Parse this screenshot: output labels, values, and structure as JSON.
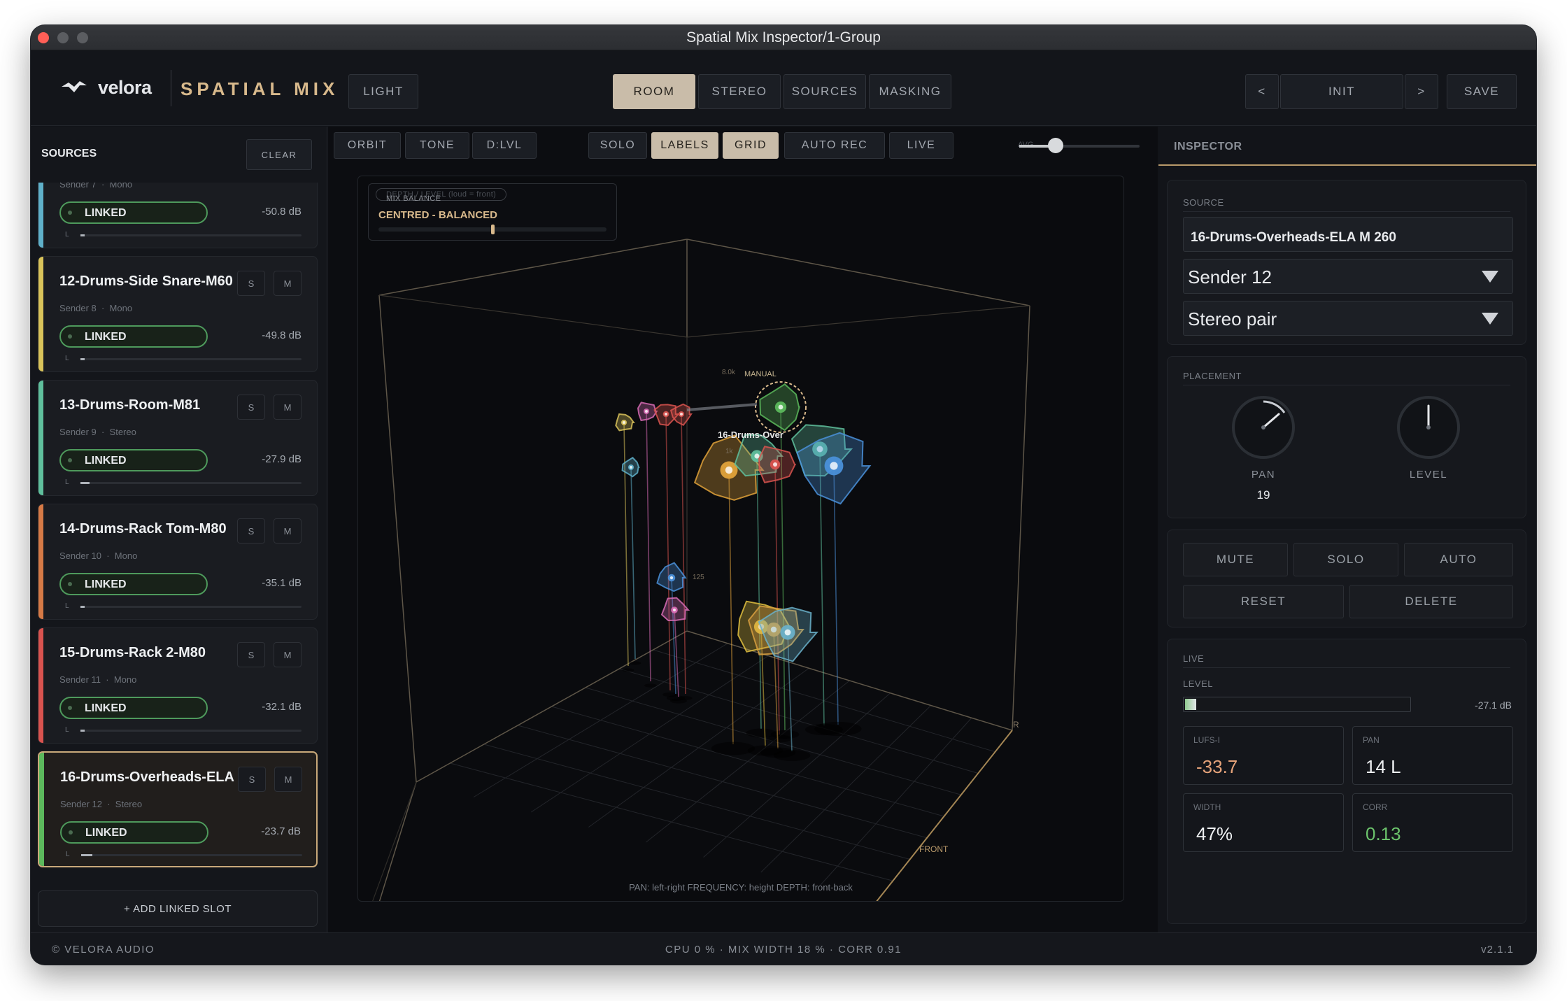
{
  "window": {
    "title": "Spatial Mix Inspector/1-Group"
  },
  "header": {
    "brand": "velora",
    "product": "SPATIAL MIX",
    "theme_button": "LIGHT",
    "view_tabs": [
      {
        "label": "ROOM",
        "active": true
      },
      {
        "label": "STEREO",
        "active": false
      },
      {
        "label": "SOURCES",
        "active": false
      },
      {
        "label": "MASKING",
        "active": false
      }
    ],
    "prev": "<",
    "preset": "INIT",
    "next": ">",
    "save": "SAVE"
  },
  "sidebar": {
    "title": "SOURCES",
    "clear": "CLEAR",
    "add_slot": "+ ADD LINKED SLOT",
    "s_label": "S",
    "m_label": "M",
    "link_label": "LINKED",
    "level_prefix": "L",
    "sources": [
      {
        "name": "",
        "sender": "Sender 7",
        "type": "Mono",
        "db": "-50.8 dB",
        "color": "#5fb0c9",
        "level": 0.02
      },
      {
        "name": "12-Drums-Side Snare-M60",
        "sender": "Sender 8",
        "type": "Mono",
        "db": "-49.8 dB",
        "color": "#d9c35a",
        "level": 0.02
      },
      {
        "name": "13-Drums-Room-M81",
        "sender": "Sender 9",
        "type": "Stereo",
        "db": "-27.9 dB",
        "color": "#5fbf9c",
        "level": 0.04
      },
      {
        "name": "14-Drums-Rack Tom-M80",
        "sender": "Sender 10",
        "type": "Mono",
        "db": "-35.1 dB",
        "color": "#d67a46",
        "level": 0.02
      },
      {
        "name": "15-Drums-Rack 2-M80",
        "sender": "Sender 11",
        "type": "Mono",
        "db": "-32.1 dB",
        "color": "#d9534f",
        "level": 0.02
      },
      {
        "name": "16-Drums-Overheads-ELA ...",
        "sender": "Sender 12",
        "type": "Stereo",
        "db": "-23.7 dB",
        "color": "#5cb85c",
        "level": 0.05,
        "selected": true
      }
    ]
  },
  "toolbar": {
    "buttons": [
      {
        "label": "ORBIT",
        "active": false
      },
      {
        "label": "TONE",
        "active": false
      },
      {
        "label": "D:LVL",
        "active": false
      },
      {
        "label": "SOLO",
        "active": false
      },
      {
        "label": "LABELS",
        "active": true
      },
      {
        "label": "GRID",
        "active": true
      },
      {
        "label": "AUTO REC",
        "active": false
      },
      {
        "label": "LIVE",
        "active": false
      }
    ],
    "zoom_label": "AVG",
    "zoom_value": 0.3
  },
  "viewport": {
    "balance_title": "MIX BALANCE",
    "balance_ghost": "DEPTH / LEVEL  (loud = front)",
    "balance_value": "CENTRED  -  BALANCED",
    "balance_position": 0.5,
    "footer": "PAN: left-right    FREQUENCY: height    DEPTH: front-back",
    "axis_front": "FRONT",
    "axis_r": "R",
    "manual_tag": "MANUAL",
    "selected_label": "16-Drums-Over",
    "freq_1": "8.0k",
    "freq_2": "1k",
    "freq_3": "125"
  },
  "inspector": {
    "title": "INSPECTOR",
    "source_label": "SOURCE",
    "source_name": "16-Drums-Overheads-ELA M 260",
    "sender": "Sender 12",
    "channel_mode": "Stereo pair",
    "placement_label": "PLACEMENT",
    "pan_label": "PAN",
    "pan_value": "19",
    "level_knob_label": "LEVEL",
    "buttons": {
      "mute": "MUTE",
      "solo": "SOLO",
      "auto": "AUTO",
      "reset": "RESET",
      "delete": "DELETE"
    },
    "live": {
      "title": "LIVE",
      "level_label": "LEVEL",
      "level_value": "-27.1 dB",
      "level_fraction": 0.05,
      "lufs_label": "LUFS-I",
      "lufs": "-33.7",
      "pan_label": "PAN",
      "pan": "14 L",
      "width_label": "WIDTH",
      "width": "47%",
      "corr_label": "CORR",
      "corr": "0.13"
    }
  },
  "footer": {
    "copyright": "© VELORA AUDIO",
    "status": "CPU 0 %   ·   MIX WIDTH 18 %   ·   CORR 0.91",
    "version": "v2.1.1"
  },
  "colors": {
    "accent": "#d8b98c",
    "active_tab": "#c9bca9",
    "linked": "#4e9a5c",
    "lufs": "#e6a37a",
    "corr": "#6cc46c"
  }
}
